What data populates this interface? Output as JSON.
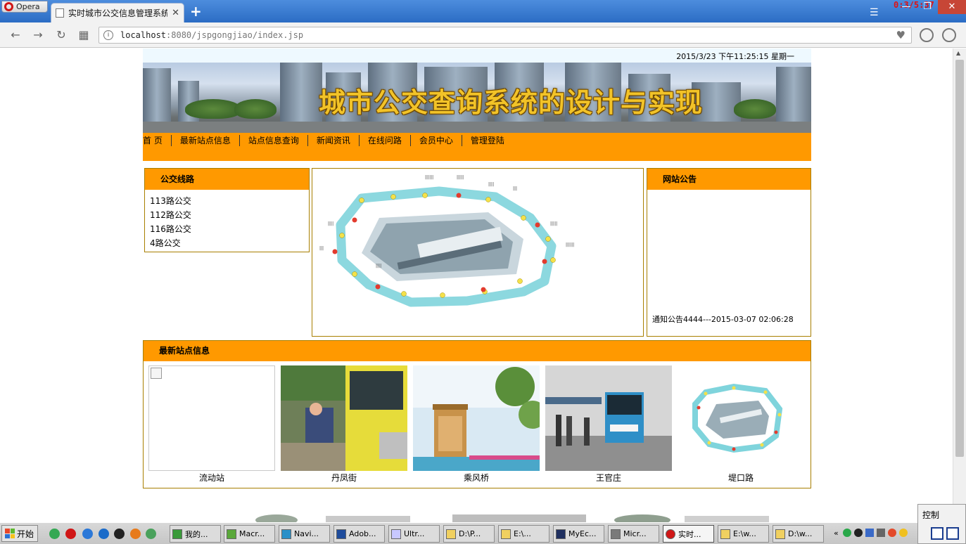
{
  "browser": {
    "menu_label": "Opera",
    "tab_title": "实时城市公交信息管理系统",
    "url_host": "localhost",
    "url_rest": ":8080/jspgongjiao/index.jsp",
    "overlay_clock": "0:3/5:37"
  },
  "site": {
    "datetime": "2015/3/23  下午11:25:15   星期一",
    "banner_title": "城市公交查询系统的设计与实现",
    "menu": [
      "首 页",
      "最新站点信息",
      "站点信息查询",
      "新闻资讯",
      "在线问路",
      "会员中心",
      "管理登陆"
    ],
    "lines_title": "公交线路",
    "lines": [
      "113路公交",
      "112路公交",
      "116路公交",
      "4路公交"
    ],
    "notice_title": "网站公告",
    "notice_item": "通知公告4444---2015-03-07 02:06:28",
    "stations_title": "最新站点信息",
    "stations": [
      "流动站",
      "丹凤街",
      "乘风桥",
      "王官庄",
      "堤口路"
    ]
  },
  "taskbar": {
    "start_label": "开始",
    "items": [
      "我的...",
      "Macr...",
      "Navi...",
      "Adob...",
      "Ultr...",
      "D:\\P...",
      "E:\\...",
      "MyEc...",
      "Micr...",
      "实时...",
      "E:\\w...",
      "D:\\w..."
    ],
    "tray_label": "控制"
  },
  "colors": {
    "accent_orange": "#ff9900",
    "box_border": "#a87f00",
    "title_gold": "#f2c328"
  }
}
